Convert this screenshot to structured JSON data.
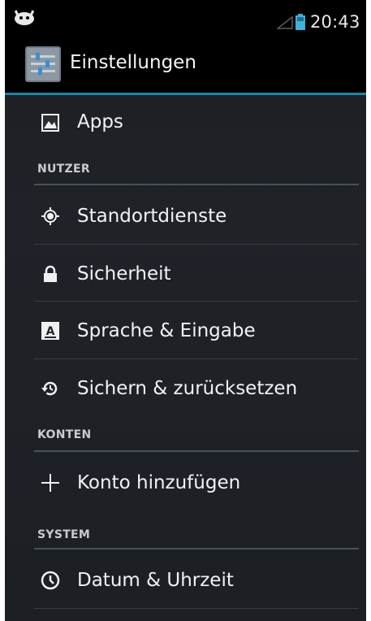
{
  "statusbar": {
    "time": "20:43",
    "notification_icon": "android-icon",
    "signal_icon": "signal-icon",
    "battery_icon": "battery-icon"
  },
  "actionbar": {
    "title": "Einstellungen",
    "icon": "settings-app-icon",
    "accent_color": "#1e85a4"
  },
  "items": {
    "apps": {
      "label": "Apps",
      "icon": "apps-icon"
    },
    "nutzer_header": "NUTZER",
    "standort": {
      "label": "Standortdienste",
      "icon": "location-icon"
    },
    "sicherheit": {
      "label": "Sicherheit",
      "icon": "lock-icon"
    },
    "sprache": {
      "label": "Sprache & Eingabe",
      "icon": "keyboard-icon"
    },
    "sichern": {
      "label": "Sichern & zurücksetzen",
      "icon": "backup-restore-icon"
    },
    "konten_header": "KONTEN",
    "konto": {
      "label": "Konto hinzufügen",
      "icon": "plus-icon"
    },
    "system_header": "SYSTEM",
    "datum": {
      "label": "Datum & Uhrzeit",
      "icon": "clock-icon"
    }
  }
}
